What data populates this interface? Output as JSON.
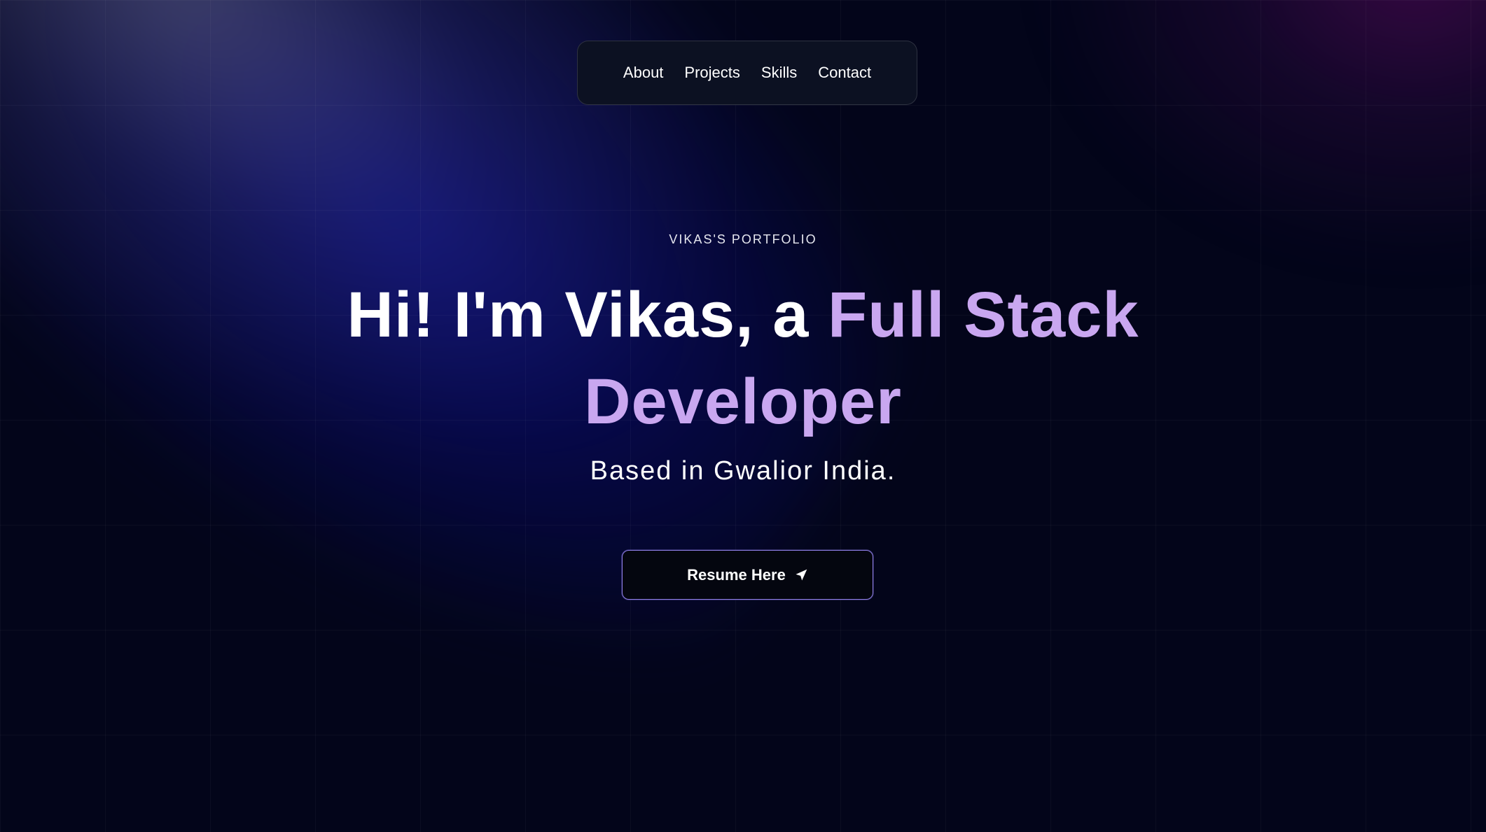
{
  "nav": {
    "items": [
      {
        "label": "About"
      },
      {
        "label": "Projects"
      },
      {
        "label": "Skills"
      },
      {
        "label": "Contact"
      }
    ]
  },
  "hero": {
    "eyebrow": "VIKAS'S PORTFOLIO",
    "headline_plain": "Hi! I'm Vikas, a ",
    "headline_accent_1": "Full Stack",
    "headline_accent_2": "Developer",
    "subtitle": "Based in Gwalior India.",
    "cta_label": "Resume Here",
    "cta_icon": "send-arrow-icon"
  },
  "colors": {
    "background": "#03051a",
    "accent": "#c9a7f0",
    "button_border": "#8f7fe8"
  }
}
